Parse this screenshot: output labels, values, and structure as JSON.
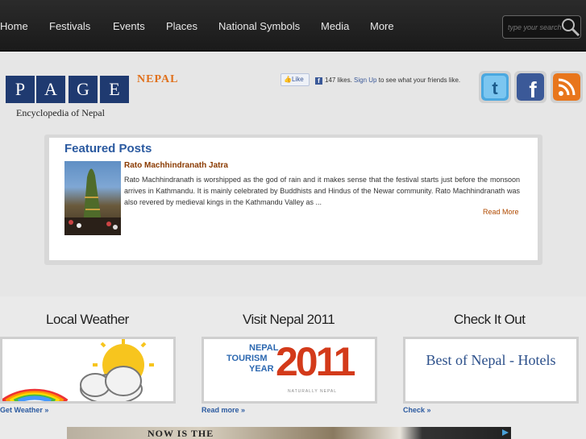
{
  "nav": {
    "items": [
      {
        "label": "Home"
      },
      {
        "label": "Festivals"
      },
      {
        "label": "Events"
      },
      {
        "label": "Places"
      },
      {
        "label": "National Symbols"
      },
      {
        "label": "Media"
      },
      {
        "label": "More"
      }
    ],
    "search_placeholder": "type your search"
  },
  "header": {
    "logo_letters": [
      "P",
      "A",
      "G",
      "E"
    ],
    "logo_nepal": "NEPAL",
    "logo_subtitle": "Encyclopedia of Nepal",
    "like_button": "Like",
    "like_count": "147 likes.",
    "sign_up": "Sign Up",
    "like_suffix": "to see what your friends like.",
    "social": [
      "twitter-icon",
      "facebook-icon",
      "rss-icon"
    ]
  },
  "featured": {
    "heading": "Featured Posts",
    "post_title": "Rato Machhindranath Jatra",
    "post_body": "Rato Machhindranath is worshipped as the god of rain and it makes sense that the festival starts just before the monsoon arrives in Kathmandu. It is mainly celebrated by Buddhists and Hindus of the Newar community. Rato Machhindranath was also revered by medieval kings in the Kathmandu Valley as ...",
    "read_more": "Read More"
  },
  "widgets": [
    {
      "title": "Local Weather",
      "link": "Get Weather »"
    },
    {
      "title": "Visit Nepal 2011",
      "link": "Read more »",
      "banner_line1": "NEPAL",
      "banner_line2": "TOURISM",
      "banner_line3": "YEAR",
      "banner_year": "2011",
      "banner_tag": "NATURALLY NEPAL"
    },
    {
      "title": "Check It Out",
      "link": "Check »",
      "box_text": "Best of Nepal - Hotels"
    }
  ],
  "ad": {
    "text": "NOW IS THE"
  },
  "colors": {
    "nav_bg": "#1f1f1f",
    "logo_blue": "#1f3a70",
    "accent_orange": "#e0701b",
    "link_blue": "#2b5aa0"
  }
}
